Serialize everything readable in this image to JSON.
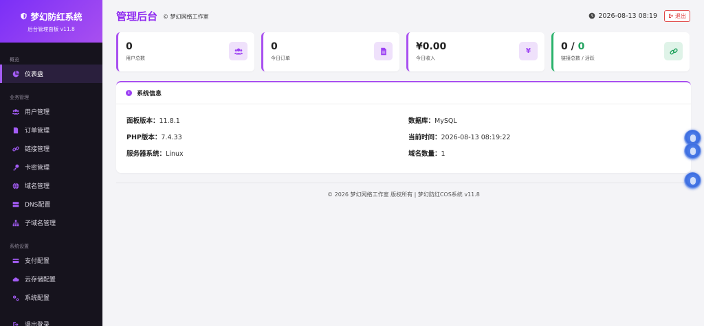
{
  "brand": {
    "title": "梦幻防红系统",
    "subtitle": "后台管理面板 v11.8"
  },
  "sidebar": {
    "sections": [
      {
        "label": "概览",
        "items": [
          {
            "label": "仪表盘",
            "icon": "pie-chart-icon",
            "active": true
          }
        ]
      },
      {
        "label": "业务管理",
        "items": [
          {
            "label": "用户管理",
            "icon": "users-icon"
          },
          {
            "label": "订单管理",
            "icon": "file-icon"
          },
          {
            "label": "链接管理",
            "icon": "link-icon"
          },
          {
            "label": "卡密管理",
            "icon": "key-icon"
          },
          {
            "label": "域名管理",
            "icon": "globe-icon"
          },
          {
            "label": "DNS配置",
            "icon": "server-icon"
          },
          {
            "label": "子域名管理",
            "icon": "sitemap-icon"
          }
        ]
      },
      {
        "label": "系统设置",
        "items": [
          {
            "label": "支付配置",
            "icon": "credit-card-icon"
          },
          {
            "label": "云存储配置",
            "icon": "cloud-icon"
          },
          {
            "label": "系统配置",
            "icon": "cogs-icon"
          }
        ]
      }
    ],
    "partial_item": {
      "label": "退出登录",
      "icon": "sign-out-icon"
    }
  },
  "header": {
    "title": "管理后台",
    "subtitle": "© 梦幻网络工作室",
    "datetime": "2026-08-13 08:19",
    "logout_label": "退出"
  },
  "stats": [
    {
      "value": "0",
      "label": "用户总数",
      "icon": "users-icon"
    },
    {
      "value": "0",
      "label": "今日订单",
      "icon": "file-icon"
    },
    {
      "value": "¥0.00",
      "label": "今日收入",
      "icon": "yen-icon"
    },
    {
      "value_total": "0",
      "value_sep": " / ",
      "value_active": "0",
      "label": "链接总数 / 活跃",
      "icon": "link-icon"
    }
  ],
  "system_info": {
    "title": "系统信息",
    "rows": [
      {
        "key": "面板版本：",
        "value": "11.8.1"
      },
      {
        "key": "PHP版本：",
        "value": "7.4.33"
      },
      {
        "key": "服务器系统：",
        "value": "Linux"
      },
      {
        "key": "数据库：",
        "value": "MySQL"
      },
      {
        "key": "当前时间：",
        "value": "2026-08-13 08:19:22"
      },
      {
        "key": "域名数量：",
        "value": "1"
      }
    ]
  },
  "footer": {
    "text": "© 2026 梦幻网络工作室 版权所有 | 梦幻防红COS系统 v11.8"
  },
  "colors": {
    "accent": "#8f2bf0",
    "sidebar_bg": "#16131d",
    "success": "#22a35f",
    "danger": "#e04646"
  }
}
